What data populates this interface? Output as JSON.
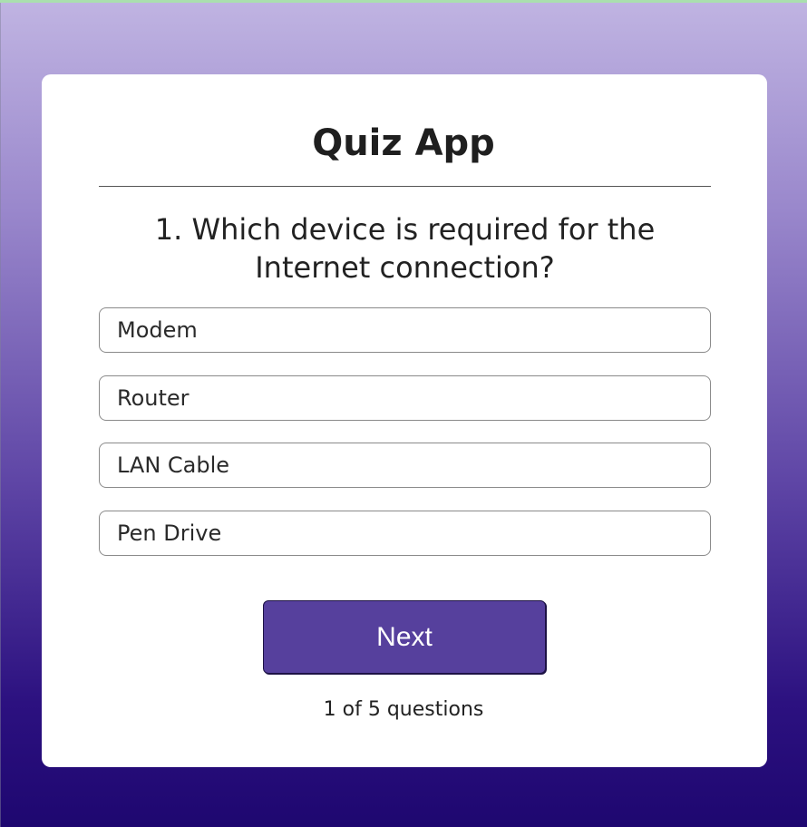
{
  "quiz": {
    "title": "Quiz App",
    "question": "1. Which device is required for the Internet connection?",
    "answers": [
      "Modem",
      "Router",
      "LAN Cable",
      "Pen Drive"
    ],
    "next_label": "Next",
    "progress": "1 of 5 questions"
  },
  "colors": {
    "accent": "#56409d",
    "background_top": "#c0b4e2",
    "background_bottom": "#1e0770",
    "card": "#ffffff"
  }
}
